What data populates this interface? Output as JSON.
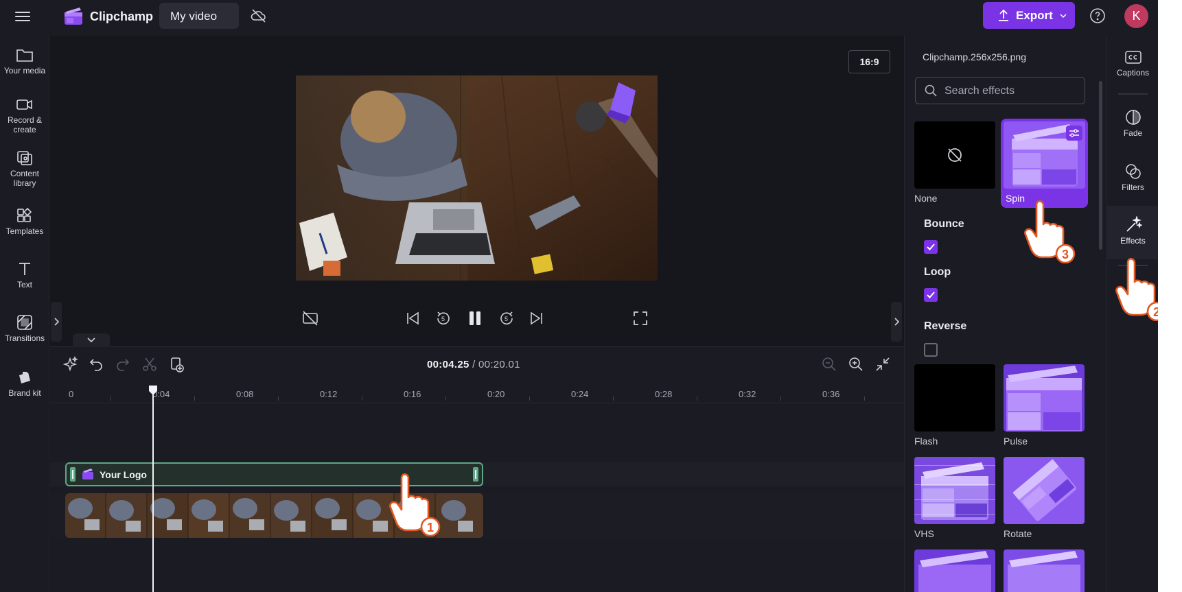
{
  "topbar": {
    "brand": "Clipchamp",
    "project_title": "My video",
    "export_label": "Export",
    "avatar_initial": "K"
  },
  "sidebar": {
    "items": [
      {
        "label_lines": [
          "Your media"
        ],
        "icon": "folder-icon"
      },
      {
        "label_lines": [
          "Record &",
          "create"
        ],
        "icon": "camera-icon"
      },
      {
        "label_lines": [
          "Content",
          "library"
        ],
        "icon": "content-library-icon"
      },
      {
        "label_lines": [
          "Templates"
        ],
        "icon": "templates-icon"
      },
      {
        "label_lines": [
          "Text"
        ],
        "icon": "text-icon"
      },
      {
        "label_lines": [
          "Transitions"
        ],
        "icon": "transitions-icon"
      },
      {
        "label_lines": [
          "Brand kit"
        ],
        "icon": "brand-kit-icon"
      }
    ]
  },
  "preview": {
    "aspect_ratio": "16:9"
  },
  "timeline": {
    "current_time": "00:04.25",
    "separator": " / ",
    "total_time": "00:20.01",
    "ruler_ticks": [
      "0",
      "0:04",
      "0:08",
      "0:12",
      "0:16",
      "0:20",
      "0:24",
      "0:28",
      "0:32",
      "0:36"
    ],
    "logo_clip_name": "Your Logo"
  },
  "effects_panel": {
    "file_name": "Clipchamp.256x256.png",
    "search_placeholder": "Search effects",
    "effects": [
      "None",
      "Spin",
      "Flash",
      "Pulse",
      "VHS",
      "Rotate"
    ],
    "selected_effect": "Spin",
    "options": [
      {
        "label": "Bounce",
        "checked": true
      },
      {
        "label": "Loop",
        "checked": true
      },
      {
        "label": "Reverse",
        "checked": false
      }
    ]
  },
  "right_rail": {
    "items": [
      "Captions",
      "Fade",
      "Filters",
      "Effects"
    ],
    "active": "Effects"
  },
  "tutorial_steps": [
    "1",
    "2",
    "3"
  ],
  "colors": {
    "accent": "#7a34e6",
    "clip_outline": "#5ea886",
    "background": "#16161d",
    "panel": "#1b1b23",
    "avatar": "#c0395e"
  }
}
